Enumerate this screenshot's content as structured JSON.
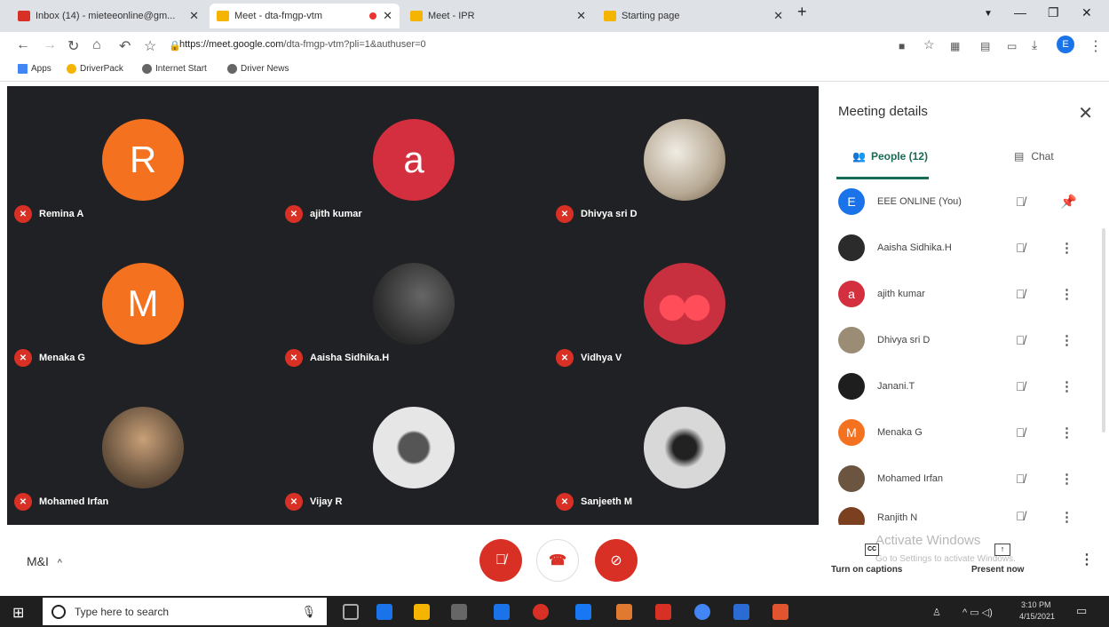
{
  "browser": {
    "tabs": [
      {
        "label": "Inbox (14) - mieteeonline@gm...",
        "color": "#d93025"
      },
      {
        "label": "Meet - dta-fmgp-vtm",
        "color": "#f4b400"
      },
      {
        "label": "Meet - IPR",
        "color": "#f4b400"
      },
      {
        "label": "Starting page",
        "color": "#f4b400"
      }
    ],
    "new_tab": "+",
    "url_host": "https://meet.google.com",
    "url_path": "/dta-fmgp-vtm?pli=1&authuser=0",
    "bookmarks": [
      "Apps",
      "DriverPack",
      "Internet Start",
      "Driver News"
    ],
    "profile_initial": "E"
  },
  "tiles": [
    {
      "name": "Remina A",
      "initial": "R",
      "color": "#f4711f"
    },
    {
      "name": "ajith kumar",
      "initial": "a",
      "color": "#d32f3f"
    },
    {
      "name": "Dhivya sri D",
      "initial": "",
      "color": "#b8aa95"
    },
    {
      "name": "Menaka G",
      "initial": "M",
      "color": "#f4711f"
    },
    {
      "name": "Aaisha Sidhika.H",
      "initial": "",
      "color": "#3a3a3a"
    },
    {
      "name": "Vidhya V",
      "initial": "",
      "color": "#c9303f"
    },
    {
      "name": "Mohamed Irfan",
      "initial": "",
      "color": "#6b5540"
    },
    {
      "name": "Vijay R",
      "initial": "",
      "color": "#d8d8d8"
    },
    {
      "name": "Sanjeeth M",
      "initial": "",
      "color": "#cfcfcf"
    }
  ],
  "panel": {
    "title": "Meeting details",
    "people_tab": "People (12)",
    "chat_tab": "Chat",
    "people": [
      {
        "name": "EEE ONLINE (You)",
        "initial": "E",
        "color": "#1a73e8",
        "action": "pin"
      },
      {
        "name": "Aaisha Sidhika.H",
        "initial": "",
        "color": "#2b2b2b",
        "action": "more"
      },
      {
        "name": "ajith kumar",
        "initial": "a",
        "color": "#d32f3f",
        "action": "more"
      },
      {
        "name": "Dhivya sri D",
        "initial": "",
        "color": "#9a8c75",
        "action": "more"
      },
      {
        "name": "Janani.T",
        "initial": "",
        "color": "#1e1e1e",
        "action": "more"
      },
      {
        "name": "Menaka G",
        "initial": "M",
        "color": "#f4711f",
        "action": "more"
      },
      {
        "name": "Mohamed Irfan",
        "initial": "",
        "color": "#6b5540",
        "action": "more"
      },
      {
        "name": "Ranjith N",
        "initial": "",
        "color": "#7a4020",
        "action": "more"
      }
    ]
  },
  "controls": {
    "meeting_label": "M&I",
    "captions": "Turn on captions",
    "present": "Present now"
  },
  "watermark": {
    "line1": "Activate Windows",
    "line2": "Go to Settings to activate Windows."
  },
  "taskbar": {
    "search_placeholder": "Type here to search",
    "time": "3:10 PM",
    "date": "4/15/2021"
  }
}
